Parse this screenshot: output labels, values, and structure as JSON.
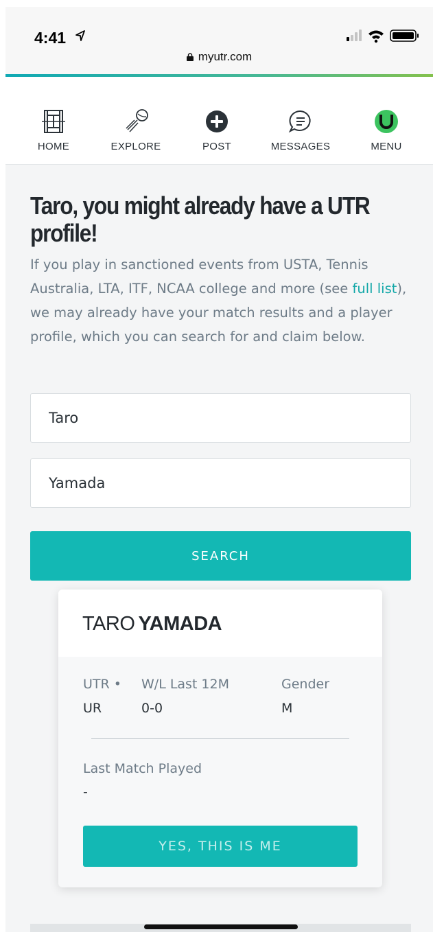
{
  "status_bar": {
    "time": "4:41",
    "url": "myutr.com"
  },
  "nav": [
    {
      "label": "HOME",
      "icon": "court-icon"
    },
    {
      "label": "EXPLORE",
      "icon": "racket-ball-icon"
    },
    {
      "label": "POST",
      "icon": "plus-circle-icon"
    },
    {
      "label": "MESSAGES",
      "icon": "chat-icon"
    },
    {
      "label": "MENU",
      "icon": "utr-logo-icon"
    }
  ],
  "main": {
    "title": "Taro, you might already have a UTR profile!",
    "intro_before": "If you play in sanctioned events from USTA, Tennis Australia, LTA, ITF, NCAA college and more (see ",
    "intro_link": "full list",
    "intro_after": "), we may already have your match results and a player profile, which you can search for and claim below.",
    "first_name_value": "Taro",
    "last_name_value": "Yamada",
    "search_label": "SEARCH"
  },
  "result": {
    "first_name": "TARO",
    "last_name": "YAMADA",
    "utr_label": "UTR •",
    "utr_value": "UR",
    "wl_label": "W/L Last 12M",
    "wl_value": "0-0",
    "gender_label": "Gender",
    "gender_value": "M",
    "last_match_label": "Last Match Played",
    "last_match_value": "-",
    "confirm_label": "YES, THIS IS ME"
  },
  "colors": {
    "accent": "#13b8b4",
    "link": "#12a7a8",
    "utr_green": "#3cc35f"
  }
}
